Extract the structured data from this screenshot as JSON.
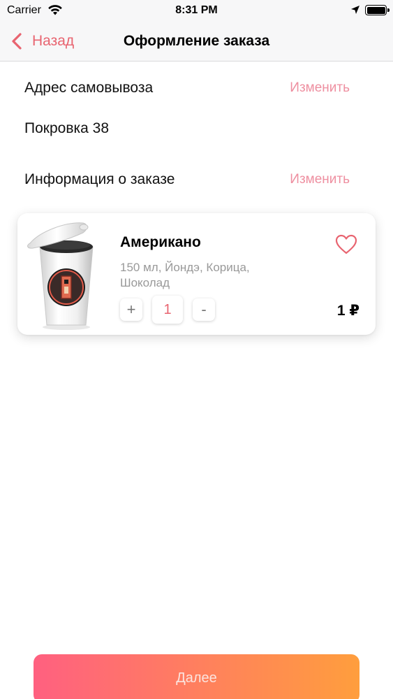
{
  "status_bar": {
    "carrier": "Carrier",
    "time": "8:31 PM"
  },
  "nav": {
    "back_label": "Назад",
    "title": "Оформление заказа"
  },
  "pickup": {
    "label": "Адрес самовывоза",
    "change_label": "Изменить",
    "address": "Покровка 38"
  },
  "order_info": {
    "label": "Информация о заказе",
    "change_label": "Изменить"
  },
  "item": {
    "name": "Американо",
    "description": "150 мл, Йондэ, Корица, Шоколад",
    "plus": "+",
    "quantity": "1",
    "minus": "-",
    "price": "1 ₽",
    "favorited": false
  },
  "actions": {
    "next_label": "Далее"
  },
  "colors": {
    "accent": "#e86470",
    "link": "#ee8fa0",
    "gradient_start": "#ff6080",
    "gradient_end": "#ff9e3d"
  }
}
